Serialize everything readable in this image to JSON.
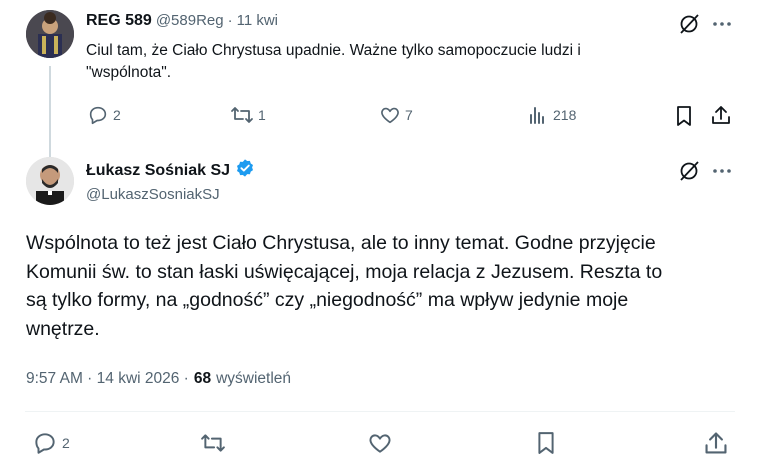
{
  "reply_tweet": {
    "name": "REG 589",
    "handle": "@589Reg",
    "sep": "·",
    "time": "11 kwi",
    "text_line1": "Ciul tam, że Ciało Chrystusa upadnie. Ważne tylko samopoczucie ludzi i",
    "text_line2": "\"wspólnota\".",
    "replies": "2",
    "retweets": "1",
    "likes": "7",
    "views": "218"
  },
  "main_tweet": {
    "name": "Łukasz Sośniak SJ",
    "handle": "@LukaszSosniakSJ",
    "text_line1": "Wspólnota to też jest Ciało Chrystusa, ale to inny temat. Godne przyjęcie",
    "text_line2": "Komunii św. to stan łaski uświęcającej, moja relacja z Jezusem. Reszta to",
    "text_line3": "są tylko formy, na „godność” czy „niegodność” ma wpływ jedynie moje",
    "text_line4": "wnętrze.",
    "timestamp": "9:57 AM · 14 kwi 2026 ·",
    "views_count": "68",
    "views_label": "wyświetleń",
    "replies": "2"
  },
  "colors": {
    "verified": "#1d9bf0",
    "muted": "#536471",
    "text": "#0f1419",
    "divider": "#eff3f4"
  }
}
